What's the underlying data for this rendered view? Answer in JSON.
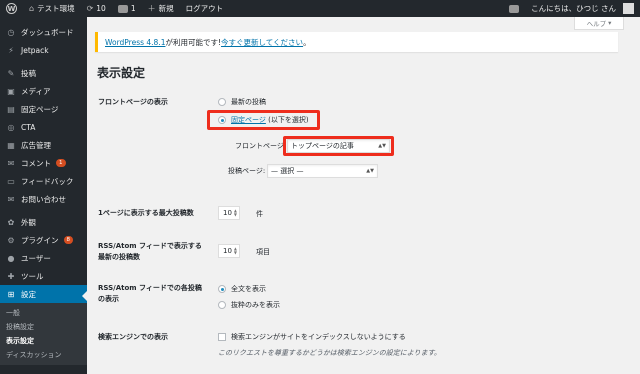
{
  "adminbar": {
    "site_name": "テスト環境",
    "updates_count": "10",
    "comments_count": "1",
    "new_label": "新規",
    "logout_label": "ログアウト",
    "greeting": "こんにちは、ひつじ さん"
  },
  "sidebar": {
    "items": [
      {
        "label": "ダッシュボード",
        "icon": "dashboard-icon",
        "glyph": "◷"
      },
      {
        "label": "Jetpack",
        "icon": "jetpack-icon",
        "glyph": "⚡"
      },
      {
        "label": "投稿",
        "icon": "pin-icon",
        "glyph": "✎"
      },
      {
        "label": "メディア",
        "icon": "media-icon",
        "glyph": "▣"
      },
      {
        "label": "固定ページ",
        "icon": "page-icon",
        "glyph": "▤"
      },
      {
        "label": "CTA",
        "icon": "cta-icon",
        "glyph": "◎"
      },
      {
        "label": "広告管理",
        "icon": "ads-icon",
        "glyph": "▦"
      },
      {
        "label": "コメント",
        "icon": "comment-icon",
        "glyph": "✉",
        "badge": "1"
      },
      {
        "label": "フィードバック",
        "icon": "feedback-icon",
        "glyph": "▭"
      },
      {
        "label": "お問い合わせ",
        "icon": "mail-icon",
        "glyph": "✉"
      },
      {
        "label": "外観",
        "icon": "appearance-icon",
        "glyph": "✿"
      },
      {
        "label": "プラグイン",
        "icon": "plugin-icon",
        "glyph": "⚙",
        "badge": "8"
      },
      {
        "label": "ユーザー",
        "icon": "users-icon",
        "glyph": "●"
      },
      {
        "label": "ツール",
        "icon": "tools-icon",
        "glyph": "✚"
      },
      {
        "label": "設定",
        "icon": "settings-icon",
        "glyph": "⊞"
      }
    ],
    "submenu": [
      "一般",
      "投稿設定",
      "表示設定",
      "ディスカッション"
    ]
  },
  "help_tab": {
    "label": "ヘルプ"
  },
  "notice": {
    "version_link": "WordPress 4.8.1",
    "text": " が利用可能です! ",
    "update_link": "今すぐ更新してください",
    "end": "。"
  },
  "page_title": "表示設定",
  "front_page": {
    "label": "フロントページの表示",
    "option_latest": "最新の投稿",
    "option_static_link": "固定ページ",
    "option_static_suffix": " (以下を選択)",
    "front_label": "フロントページ:",
    "front_value": "トップページの記事",
    "posts_label": "投稿ページ:",
    "posts_value": "— 選択 —"
  },
  "posts_per_page": {
    "label": "1ページに表示する最大投稿数",
    "value": "10",
    "unit": "件"
  },
  "rss_count": {
    "label_line1": "RSS/Atom フィードで表示する",
    "label_line2": "最新の投稿数",
    "value": "10",
    "unit": "項目"
  },
  "rss_content": {
    "label_line1": "RSS/Atom フィードでの各投稿",
    "label_line2": "の表示",
    "option_full": "全文を表示",
    "option_summary": "抜粋のみを表示"
  },
  "search_engine": {
    "label": "検索エンジンでの表示",
    "checkbox_label": "検索エンジンがサイトをインデックスしないようにする",
    "note": "このリクエストを尊重するかどうかは検索エンジンの設定によります。"
  },
  "colors": {
    "accent": "#0073aa",
    "highlight": "#ee2d1d",
    "notice": "#ffb900"
  }
}
